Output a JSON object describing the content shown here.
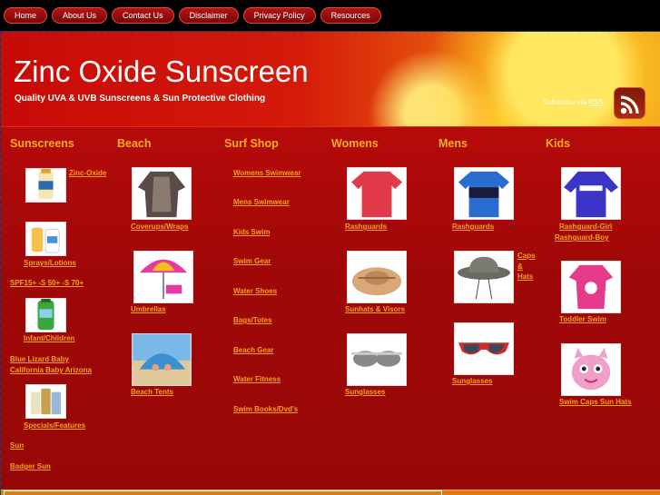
{
  "nav": [
    "Home",
    "About Us",
    "Contact Us",
    "Disclaimer",
    "Privacy Policy",
    "Resources"
  ],
  "header": {
    "title": "Zinc Oxide Sunscreen",
    "tagline": "Quality UVA & UVB Sunscreens & Sun Protective Clothing",
    "rss_prefix": "Subscribe via ",
    "rss_link": "RSS"
  },
  "columns": {
    "sunscreens": {
      "heading": "Sunscreens",
      "zinc_oxide": "Zinc-Oxide",
      "sprays": "Sprays/Lotions",
      "spf": "SPF15+ -S 50+ -S 70+",
      "infant": "Infant/Children",
      "blue_lizard": "Blue Lizard Baby",
      "california": "California Baby Arizona",
      "specials": "Specials/Features",
      "sun": "Sun",
      "badger": "Badger Sun"
    },
    "beach": {
      "heading": "Beach",
      "coverups": "Coverups/Wraps",
      "umbrellas": "Umbrellas",
      "tents": "Beach Tents"
    },
    "surf": {
      "heading": "Surf Shop",
      "links": [
        "Womens Swimwear",
        "Mens Swimwear",
        "Kids Swim",
        "Swim Gear",
        "Water Shoes",
        "Bags/Totes",
        "Beach Gear",
        "Water Fitness",
        "Swim Books/Dvd's"
      ]
    },
    "womens": {
      "heading": "Womens",
      "rashguards": "Rashguards",
      "sunhats": "Sunhats & Visors",
      "sunglasses": "Sunglasses"
    },
    "mens": {
      "heading": "Mens",
      "rashguards": "Rashguards",
      "caps_1": "Caps",
      "caps_2": "&",
      "caps_3": "Hats",
      "sunglasses": "Sunglasses"
    },
    "kids": {
      "heading": "Kids",
      "rash_girl": "Rashguard-Girl",
      "rash_boy": "Rashguard-Boy",
      "toddler": "Toddler Swim",
      "swimcaps": "Swim Caps Sun Hats"
    }
  },
  "colors": {
    "accent": "#f5a21a",
    "background": "#a00808",
    "nav_button": "#a00d0d"
  }
}
